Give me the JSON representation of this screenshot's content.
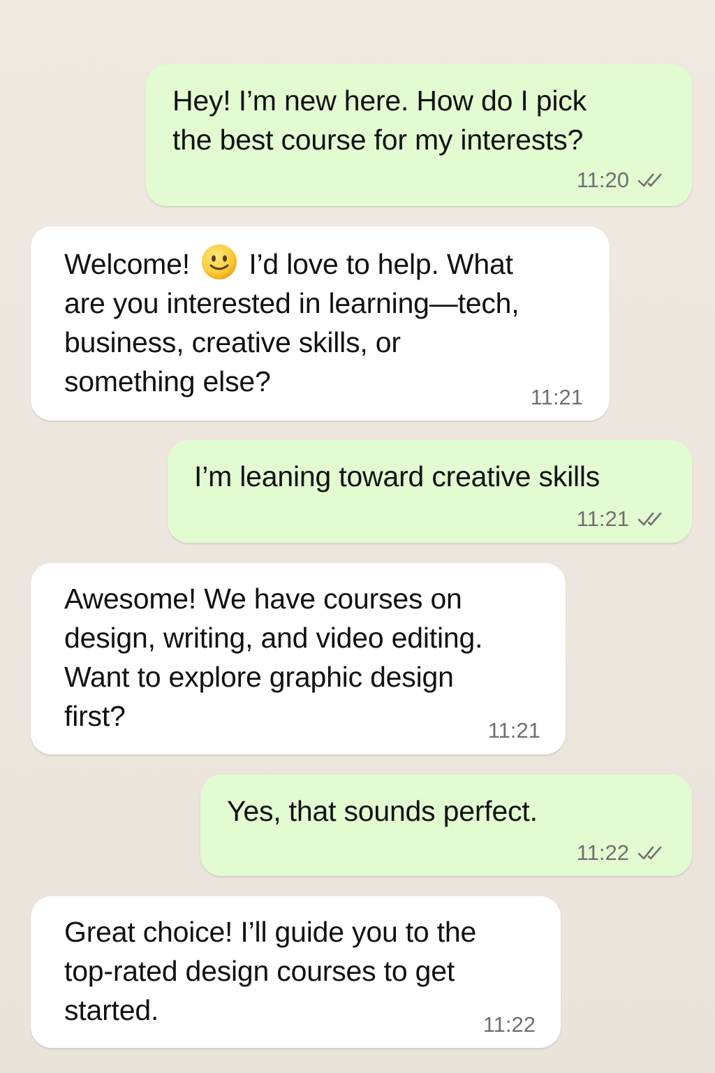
{
  "colors": {
    "background": "#ece6de",
    "outgoing_bubble": "#e2fbd1",
    "incoming_bubble": "#ffffff",
    "text": "#111111",
    "timestamp": "#6f6f6f",
    "ticks": "#6f6f6f"
  },
  "messages": [
    {
      "direction": "outgoing",
      "lines": [
        "Hey! I’m new here. How do I pick",
        "the best course for my interests?"
      ],
      "time": "11:20",
      "status_icon": "double-check-icon"
    },
    {
      "direction": "incoming",
      "lines_before_emoji": "Welcome!",
      "emoji": "slightly-smiling-face-icon",
      "lines_after_emoji": "I’d love to help. What",
      "lines": [
        "are you interested in learning—tech,",
        "business, creative skills, or",
        "something else?"
      ],
      "time": "11:21"
    },
    {
      "direction": "outgoing",
      "lines": [
        "I’m leaning toward creative skills"
      ],
      "time": "11:21",
      "status_icon": "double-check-icon"
    },
    {
      "direction": "incoming",
      "lines": [
        "Awesome! We have courses on",
        "design, writing, and video editing.",
        "Want to explore graphic design",
        "first?"
      ],
      "time": "11:21"
    },
    {
      "direction": "outgoing",
      "lines": [
        "Yes, that sounds perfect."
      ],
      "time": "11:22",
      "status_icon": "double-check-icon"
    },
    {
      "direction": "incoming",
      "lines": [
        "Great choice! I’ll guide you to the",
        "top-rated design courses to get",
        "started."
      ],
      "time": "11:22"
    }
  ]
}
